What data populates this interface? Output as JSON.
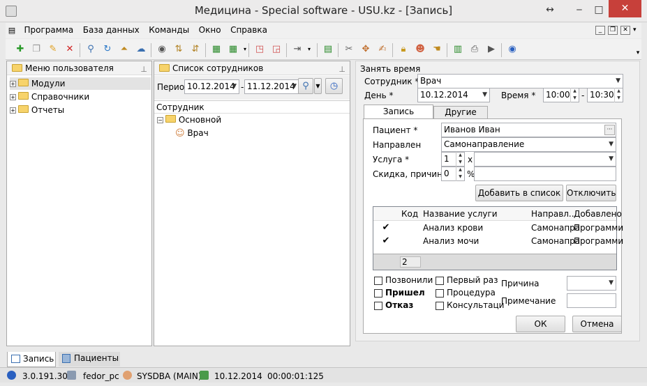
{
  "window": {
    "title": "Медицина - Special software - USU.kz - [Запись]"
  },
  "menu": [
    "Программа",
    "База данных",
    "Команды",
    "Окно",
    "Справка"
  ],
  "left_panel": {
    "title": "Меню пользователя",
    "items": [
      "Модули",
      "Справочники",
      "Отчеты"
    ]
  },
  "mid_panel": {
    "title": "Список сотрудников",
    "period_label": "Период",
    "date_from": "10.12.2014",
    "dash": "-",
    "date_to": "11.12.2014",
    "column_header": "Сотрудник",
    "group": "Основной",
    "employee": "Врач"
  },
  "right_panel": {
    "group_title": "Занять время",
    "employee_label": "Сотрудник *",
    "employee_value": "Врач",
    "day_label": "День *",
    "day_value": "10.12.2014",
    "time_label": "Время *",
    "time_from": "10:00",
    "time_dash": "-",
    "time_to": "10:30",
    "tabs": [
      "Запись пациента",
      "Другие дела"
    ],
    "patient_label": "Пациент *",
    "patient_value": "Иванов Иван",
    "referral_label": "Направлен",
    "referral_value": "Самонаправление",
    "service_label": "Услуга *",
    "service_qty": "1",
    "service_x": "x",
    "discount_label": "Скидка, причина",
    "discount_value": "0",
    "percent": "%",
    "add_button": "Добавить в список",
    "disable_button": "Отключить",
    "grid": {
      "headers": [
        "Код",
        "Название услуги",
        "Направл...",
        "Добавлено"
      ],
      "rows": [
        {
          "name": "Анализ крови",
          "ref": "Самонапра",
          "added": "Программи"
        },
        {
          "name": "Анализ мочи",
          "ref": "Самонапра",
          "added": "Программи"
        }
      ],
      "footer_count": "2"
    },
    "checks": [
      "Позвонили",
      "Пришел",
      "Отказ",
      "Первый раз",
      "Процедура",
      "Консультаци"
    ],
    "reason_label": "Причина",
    "note_label": "Примечание",
    "ok_button": "ОК",
    "cancel_button": "Отмена"
  },
  "bottom_tabs": [
    "Запись",
    "Пациенты"
  ],
  "status": {
    "version": "3.0.191.30",
    "pc": "fedor_pc",
    "user": "SYSDBA (MAIN)",
    "date": "10.12.2014",
    "timer": "00:00:01:125"
  }
}
